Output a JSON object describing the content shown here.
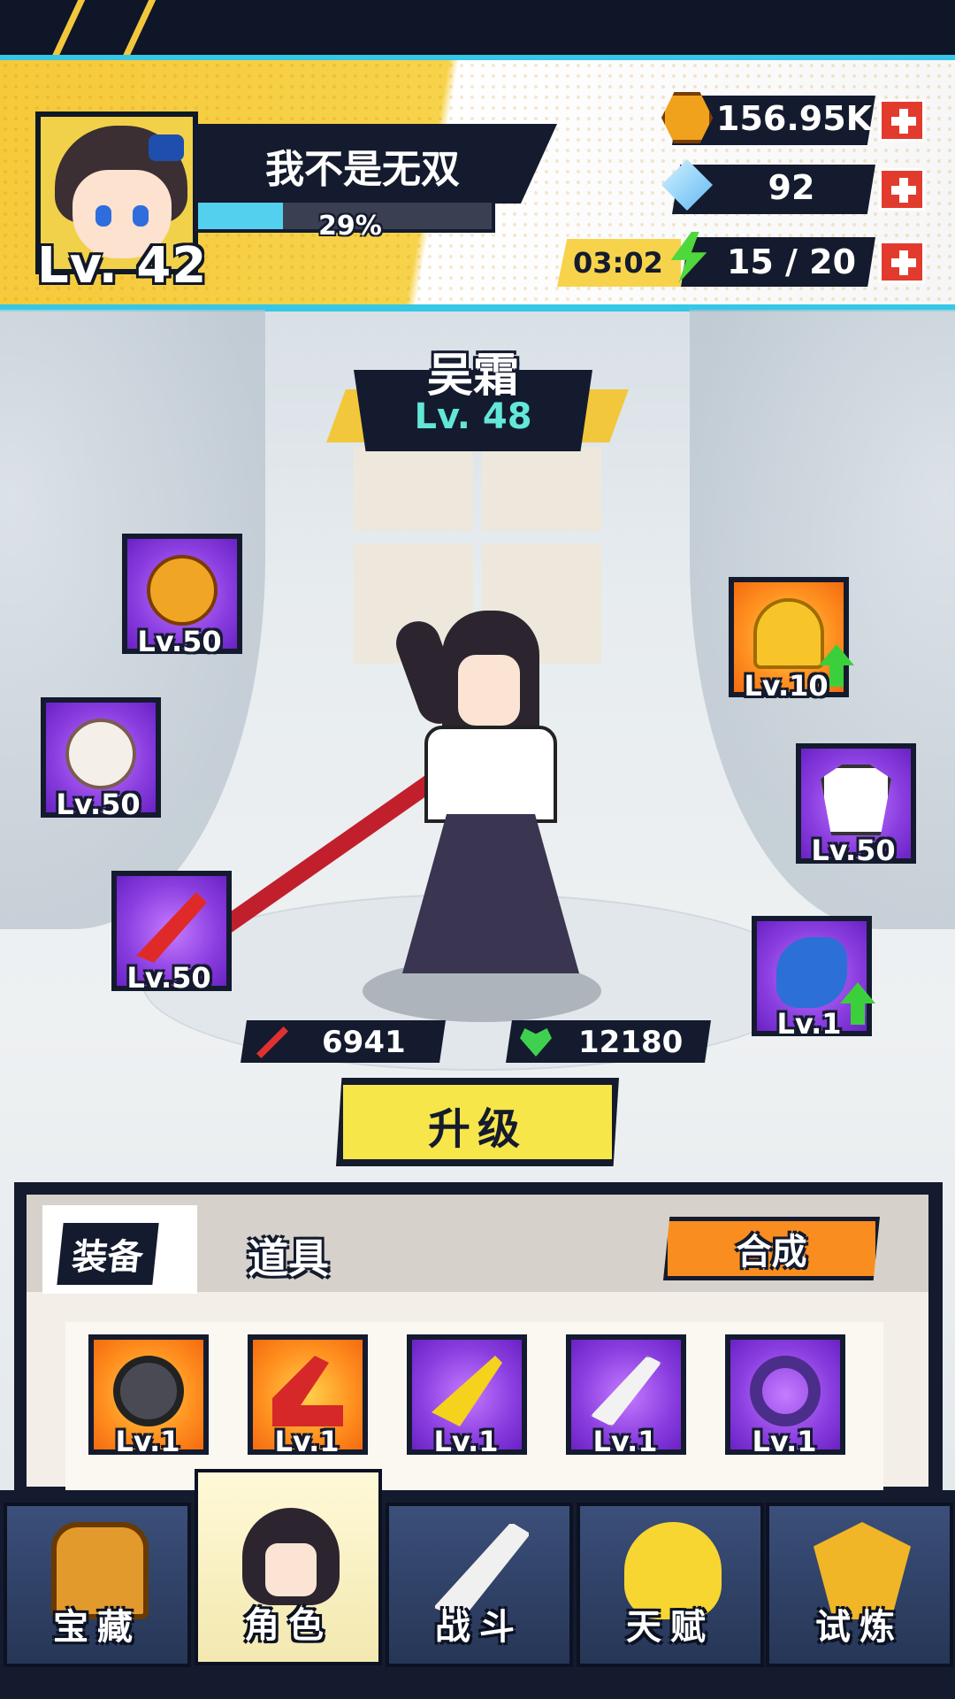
{
  "player": {
    "name": "我不是无双",
    "level_label": "Lv. 42",
    "xp_percent_label": "29%",
    "xp_fraction": 0.29
  },
  "resources": {
    "coins": "156.95K",
    "gems": "92",
    "energy": "15 / 20",
    "energy_timer": "03:02",
    "coin_icon": "paw-coin-icon",
    "gem_icon": "blue-diamond-icon",
    "energy_icon": "lightning-bolt-icon"
  },
  "hero": {
    "name": "吴霜",
    "level_label": "Lv. 48",
    "attack": "6941",
    "health": "12180"
  },
  "equipped_slots": [
    {
      "name": "bear-charm",
      "level": "Lv.50",
      "rarity": "purple",
      "upgrade": false
    },
    {
      "name": "ring",
      "level": "Lv.50",
      "rarity": "purple",
      "upgrade": false
    },
    {
      "name": "red-sword",
      "level": "Lv.50",
      "rarity": "purple",
      "upgrade": false
    },
    {
      "name": "yellow-helmet",
      "level": "Lv.10",
      "rarity": "orange",
      "upgrade": true
    },
    {
      "name": "sailor-uniform",
      "level": "Lv.50",
      "rarity": "purple",
      "upgrade": false
    },
    {
      "name": "blue-shoes",
      "level": "Lv.1",
      "rarity": "purple",
      "upgrade": true
    }
  ],
  "upgrade_button": "升级",
  "inventory": {
    "tabs": [
      "装备",
      "道具"
    ],
    "active_tab": "装备",
    "synthesize_button": "合成",
    "items": [
      {
        "name": "headband",
        "level": "Lv.1",
        "rarity": "orange"
      },
      {
        "name": "red-heel",
        "level": "Lv.1",
        "rarity": "orange"
      },
      {
        "name": "banana-blade",
        "level": "Lv.1",
        "rarity": "purple"
      },
      {
        "name": "white-knife",
        "level": "Lv.1",
        "rarity": "purple"
      },
      {
        "name": "dark-hook",
        "level": "Lv.1",
        "rarity": "purple"
      }
    ]
  },
  "nav": [
    {
      "label": "宝藏",
      "icon": "treasure-chest-icon"
    },
    {
      "label": "角色",
      "icon": "character-portrait-icon"
    },
    {
      "label": "战斗",
      "icon": "crossed-blades-icon"
    },
    {
      "label": "天赋",
      "icon": "light-bulb-icon"
    },
    {
      "label": "试炼",
      "icon": "trophy-crest-icon"
    }
  ],
  "active_nav": "角色",
  "colors": {
    "accent_yellow": "#f5c93a",
    "accent_cyan": "#35c7e6",
    "dark_navy": "#141b2e",
    "rarity_purple": "#8a3ee0",
    "rarity_orange": "#ff8f1f",
    "level_teal": "#62e7d8"
  }
}
